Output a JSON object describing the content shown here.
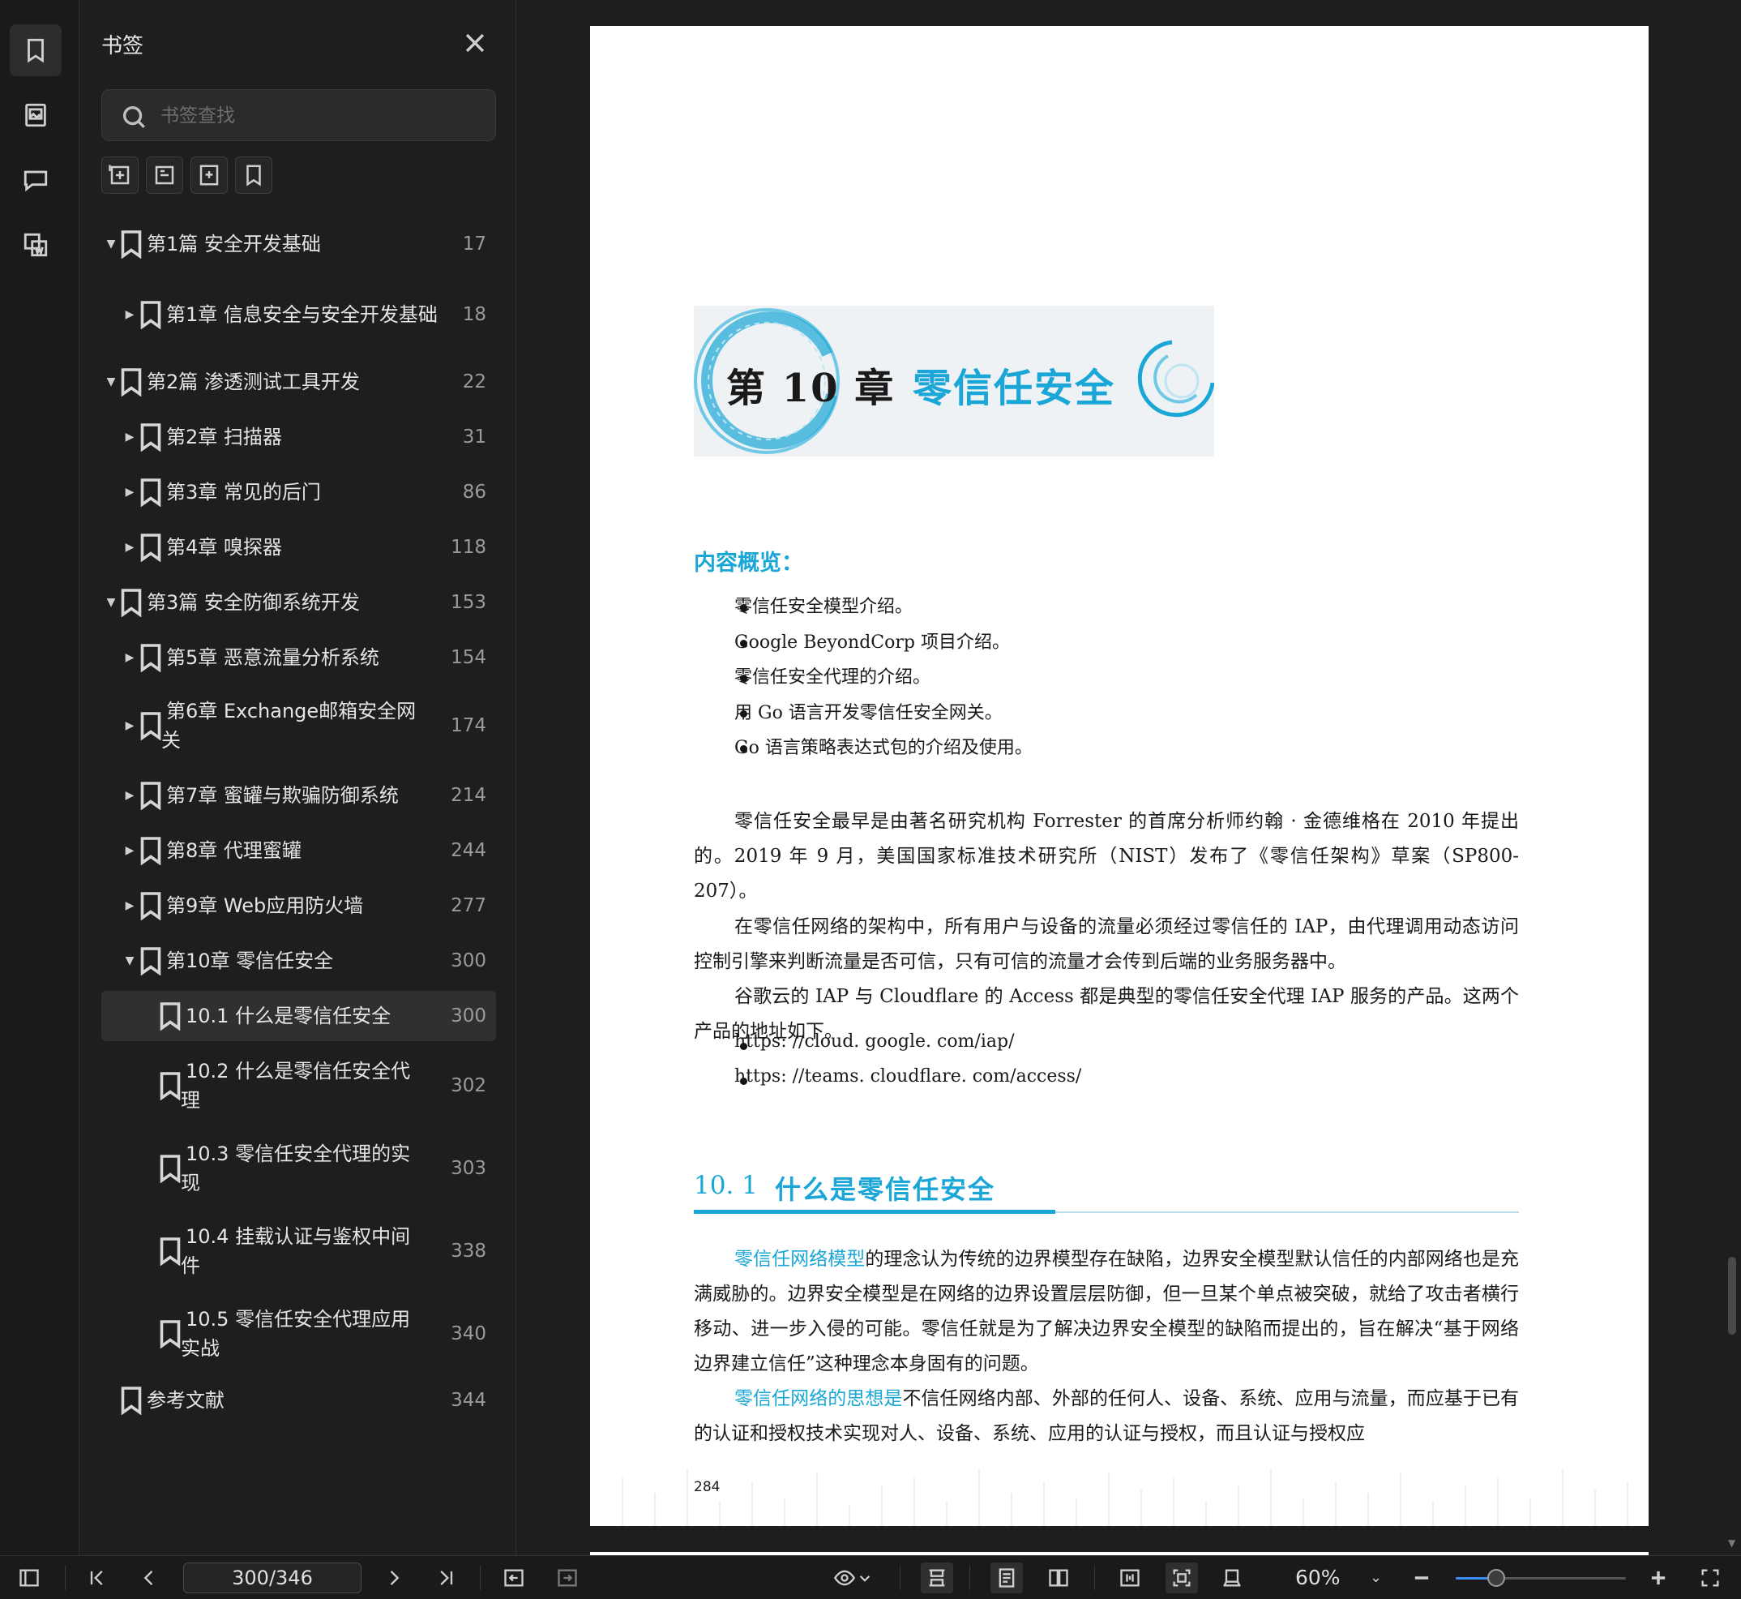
{
  "sidebar": {
    "title": "书签",
    "search_placeholder": "书签查找",
    "bookmarks": [
      {
        "label": "第1篇 安全开发基础",
        "page": "17"
      },
      {
        "label": "第1章 信息安全与安全开发基础",
        "page": "18"
      },
      {
        "label": "第2篇 渗透测试工具开发",
        "page": "22"
      },
      {
        "label": "第2章 扫描器",
        "page": "31"
      },
      {
        "label": "第3章 常见的后门",
        "page": "86"
      },
      {
        "label": "第4章 嗅探器",
        "page": "118"
      },
      {
        "label": "第3篇 安全防御系统开发",
        "page": "153"
      },
      {
        "label": "第5章 恶意流量分析系统",
        "page": "154"
      },
      {
        "label": "第6章 Exchange邮箱安全网",
        "label2": "关",
        "page": "174"
      },
      {
        "label": "第7章 蜜罐与欺骗防御系统",
        "page": "214"
      },
      {
        "label": "第8章 代理蜜罐",
        "page": "244"
      },
      {
        "label": "第9章 Web应用防火墙",
        "page": "277"
      },
      {
        "label": "第10章 零信任安全",
        "page": "300"
      },
      {
        "label": "10.1 什么是零信任安全",
        "page": "300"
      },
      {
        "label": "10.2 什么是零信任安全代",
        "label2": "理",
        "page": "302"
      },
      {
        "label": "10.3 零信任安全代理的实",
        "label2": "现",
        "page": "303"
      },
      {
        "label": "10.4 挂载认证与鉴权中间",
        "label2": "件",
        "page": "338"
      },
      {
        "label": "10.5 零信任安全代理应用",
        "label2": "实战",
        "page": "340"
      },
      {
        "label": "参考文献",
        "page": "344"
      }
    ]
  },
  "document": {
    "chapter_number": "第 10 章",
    "chapter_title": "零信任安全",
    "overview_title": "内容概览：",
    "overview_items": [
      "零信任安全模型介绍。",
      "Google BeyondCorp 项目介绍。",
      "零信任安全代理的介绍。",
      "用 Go 语言开发零信任安全网关。",
      "Go 语言策略表达式包的介绍及使用。"
    ],
    "para1": "零信任安全最早是由著名研究机构 Forrester 的首席分析师约翰 · 金德维格在 2010 年提出的。2019 年 9 月，美国国家标准技术研究所（NIST）发布了《零信任架构》草案（SP800-207）。",
    "para2": "在零信任网络的架构中，所有用户与设备的流量必须经过零信任的 IAP，由代理调用动态访问控制引擎来判断流量是否可信，只有可信的流量才会传到后端的业务服务器中。",
    "para3": "谷歌云的 IAP 与 Cloudflare 的 Access 都是典型的零信任安全代理 IAP 服务的产品。这两个产品的地址如下。",
    "urls": [
      "https: //cloud. google. com/iap/",
      "https: //teams. cloudflare. com/access/"
    ],
    "section_number": "10. 1",
    "section_title": "什么是零信任安全",
    "para4_hl": "零信任网络模型",
    "para4": "的理念认为传统的边界模型存在缺陷，边界安全模型默认信任的内部网络也是充满威胁的。边界安全模型是在网络的边界设置层层防御，但一旦某个单点被突破，就给了攻击者横行移动、进一步入侵的可能。零信任就是为了解决边界安全模型的缺陷而提出的，旨在解决“基于网络边界建立信任”这种理念本身固有的问题。",
    "para5_hl": "零信任网络的思想是",
    "para5": "不信任网络内部、外部的任何人、设备、系统、应用与流量，而应基于已有的认证和授权技术实现对人、设备、系统、应用的认证与授权，而且认证与授权应",
    "page_number": "284"
  },
  "toolbar": {
    "page_indicator": "300/346",
    "zoom": "60%",
    "zoom_fraction": 0.24
  },
  "colors": {
    "accent": "#1aa6d6",
    "background": "#1e1e1e",
    "selection": "#303030",
    "slider": "#3a8ef6"
  }
}
